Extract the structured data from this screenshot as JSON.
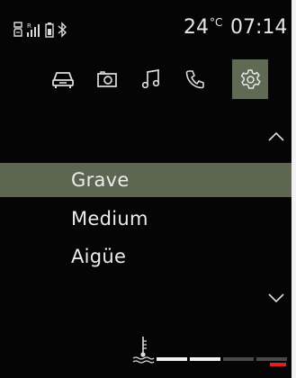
{
  "status": {
    "temperature": "24",
    "temperature_unit": "°C",
    "time": "07:14",
    "icons": [
      "sim-card-icon",
      "signal-strength-icon",
      "phone-battery-icon",
      "bluetooth-icon"
    ]
  },
  "tabs": [
    {
      "name": "car",
      "icon": "car-icon",
      "active": false
    },
    {
      "name": "camera",
      "icon": "camera-icon",
      "active": false
    },
    {
      "name": "music",
      "icon": "music-note-icon",
      "active": false
    },
    {
      "name": "phone",
      "icon": "phone-icon",
      "active": false
    },
    {
      "name": "settings",
      "icon": "gear-icon",
      "active": true
    }
  ],
  "list": {
    "items": [
      {
        "label": "Grave",
        "selected": true
      },
      {
        "label": "Medium",
        "selected": false
      },
      {
        "label": "Aigüe",
        "selected": false
      }
    ]
  },
  "gauge": {
    "icon": "coolant-temperature-icon",
    "segments": [
      "#f2f2f2",
      "#f2f2f2",
      "#4a4a4a",
      "#4a4a4a"
    ],
    "warning_color": "#e02020"
  },
  "colors": {
    "background": "#050505",
    "highlight": "#5d6651",
    "text": "#e6e6e6"
  }
}
